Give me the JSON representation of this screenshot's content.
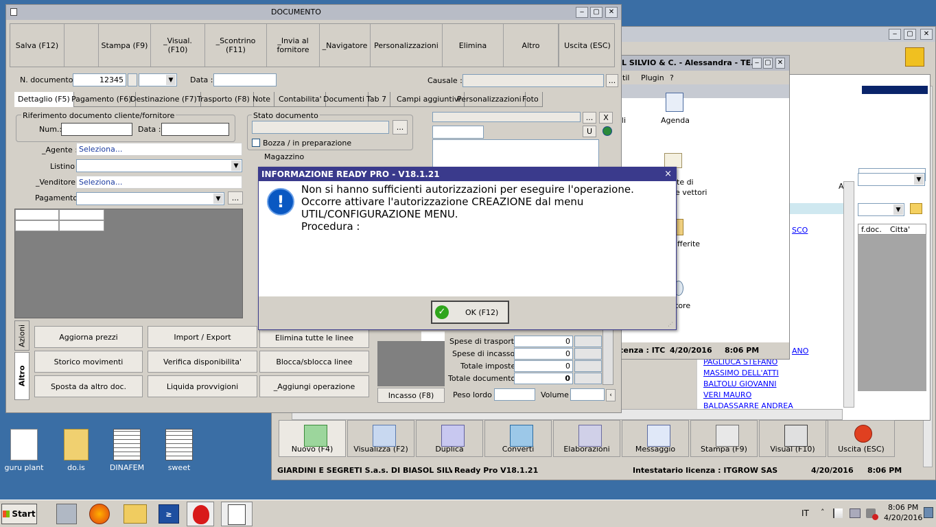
{
  "colors": {
    "desktop": "#3a6ea5",
    "titlebar": "#b8bcc6",
    "dialog_title": "#3a3a8c",
    "info_blue": "#0a58c2",
    "link": "#0000ff",
    "ok_green": "#2fa51c"
  },
  "documento": {
    "title": "DOCUMENTO",
    "toolbar": [
      "Salva (F12)",
      "",
      "Stampa (F9)",
      "_Visual. (F10)",
      "_Scontrino (F11)",
      "_Invia al fornitore",
      "_Navigatore",
      "Personalizzazioni",
      "Elimina",
      "Altro",
      "Uscita (ESC)"
    ],
    "n_doc_label": "N. documento :",
    "n_doc_value": "12345",
    "data_label": "Data :",
    "causale_label": "Causale :",
    "tabs": [
      "Dettaglio (F5)",
      "Pagamento (F6)",
      "Destinazione (F7)",
      "Trasporto (F8)",
      "Note",
      "Contabilita'",
      "Documenti",
      "Tab 7",
      "Campi aggiuntivi",
      "Personalizzazioni",
      "Foto"
    ],
    "rif_title": "Riferimento documento cliente/fornitore",
    "num_label": "Num.:",
    "rif_data_label": "Data :",
    "stato_title": "Stato documento",
    "bozza_label": "Bozza / in preparazione",
    "agente_label": "_Agente :",
    "agente_value": "Seleziona...",
    "listino_label": "Listino :",
    "venditore_label": "_Venditore :",
    "venditore_value": "Seleziona...",
    "pagamento_label": "Pagamento :",
    "magazzino_label": "Magazzino",
    "side_tabs": [
      "Azioni",
      "Altro"
    ],
    "actions": [
      "Aggiorna prezzi",
      "Import / Export",
      "Elimina tutte le linee",
      "Storico movimenti",
      "Verifica disponibilita'",
      "Blocca/sblocca linee",
      "Sposta da altro doc.",
      "Liquida provvigioni",
      "_Aggiungi operazione"
    ],
    "u_button": "U",
    "x_button": "X",
    "dots": "...",
    "totals": [
      {
        "label": "Spese di trasporto :",
        "value": "0"
      },
      {
        "label": "Spese di incasso :",
        "value": "0"
      },
      {
        "label": "Totale imposte :",
        "value": "0"
      },
      {
        "label": "Totale documento :",
        "value": "0"
      }
    ],
    "incasso_button": "Incasso (F8)",
    "peso_label": "Peso lordo :",
    "volume_label": "Volume :"
  },
  "dialog": {
    "title": "INFORMAZIONE READY PRO - V18.1.21",
    "close": "×",
    "lines": [
      "Non si hanno sufficienti autorizzazioni per eseguire l'operazione.",
      "Occorre attivare l'autorizzazione CREAZIONE dal menu",
      "UTIL/CONFIGURAZIONE MENU.",
      "Procedura :"
    ],
    "ok_label": "OK (F12)"
  },
  "middle_window": {
    "title": "L SILVIO & C. - Alessandra - TE...",
    "menu": [
      "til",
      "Plugin",
      "?"
    ],
    "items": [
      "Agenda",
      "te di",
      "e vettori",
      "ifferite",
      "tore"
    ],
    "left_fragment": "li",
    "status": [
      "cenza : ITC",
      "4/20/2016",
      "8:06 PM"
    ]
  },
  "back_window": {
    "columns": [
      "f.doc.",
      "Citta'"
    ],
    "col_a": "A",
    "names": [
      "SCO",
      "ANO",
      "PAGLIUCA STEFANO",
      "MASSIMO DELL'ATTI",
      "BALTOLU GIOVANNI",
      "VERI MAURO",
      "BALDASSARRE ANDREA"
    ],
    "toolbar": [
      "Nuovo (F4)",
      "Visualizza (F2)",
      "Duplica",
      "Converti",
      "Elaborazioni",
      "Messaggio",
      "Stampa (F9)",
      "Visual (F10)",
      "Uscita (ESC)"
    ],
    "status": {
      "company": "GIARDINI E SEGRETI S.a.s. DI BIASOL SILVIO &",
      "version": "Ready Pro V18.1.21",
      "license": "Intestatario licenza : ITGROW SAS",
      "date": "4/20/2016",
      "time": "8:06 PM"
    }
  },
  "desktop_icons": [
    "guru plant",
    "do.is",
    "DINAFEM",
    "sweet"
  ],
  "taskbar": {
    "start": "Start",
    "lang": "IT",
    "time": "8:06 PM",
    "date": "4/20/2016"
  }
}
